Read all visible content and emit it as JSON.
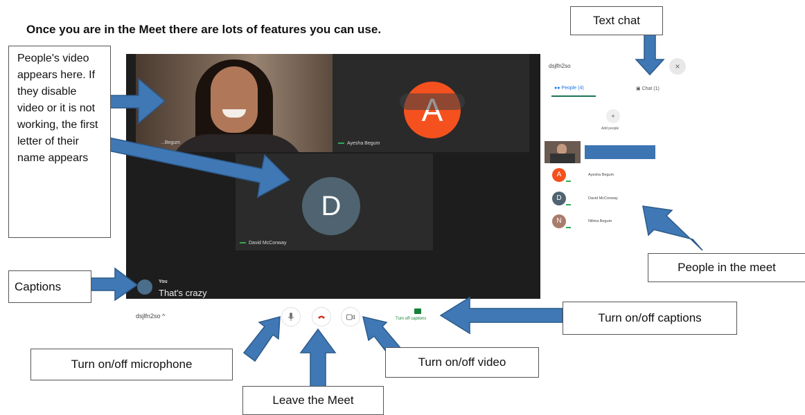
{
  "heading": "Once you are in the Meet there are lots of features you can use.",
  "meet": {
    "tiles": {
      "person_name": "...Begum",
      "ayesha_initial": "A",
      "ayesha_name": "Ayesha Begum",
      "david_initial": "D",
      "david_name": "David McConway"
    },
    "caption": {
      "speaker": "You",
      "text": "That's crazy"
    },
    "bottom_bar": {
      "meeting_code": "dsjlfn2so ^",
      "mic_icon": "microphone-icon",
      "hangup_icon": "phone-hangup-icon",
      "camera_icon": "camera-icon",
      "captions_label": "Turn off captions"
    },
    "panel": {
      "meeting_code": "dsjlfn2so",
      "close_glyph": "×",
      "tab_people": "People (4)",
      "tab_chat": "Chat (1)",
      "add_people": "Add people",
      "participants": [
        {
          "initial": "A",
          "name": "Ayesha Begum",
          "color": "#f4511e"
        },
        {
          "initial": "D",
          "name": "David McConway",
          "color": "#4f6470"
        },
        {
          "initial": "N",
          "name": "Nilima Begum",
          "color": "#a97c6c"
        }
      ]
    }
  },
  "callouts": {
    "people_video": "People's video appears here. If they disable video or it is not working, the first letter of their name appears",
    "text_chat": "Text chat",
    "captions": "Captions",
    "people_in_meet": "People in the meet",
    "toggle_captions": "Turn on/off captions",
    "toggle_microphone": "Turn on/off microphone",
    "toggle_video": "Turn on/off video",
    "leave": "Leave the Meet"
  },
  "colors": {
    "arrow": "#3f78b5",
    "arrow_outline": "#2c5a8a",
    "google_green": "#34a853"
  }
}
